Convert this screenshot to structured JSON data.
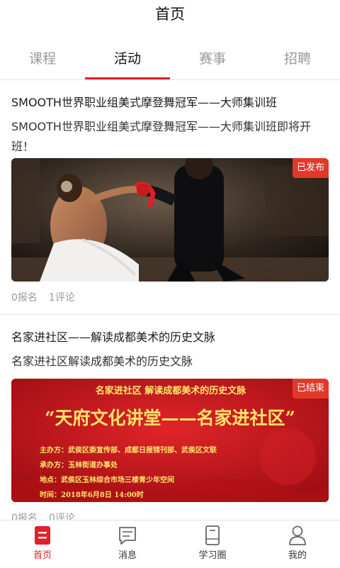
{
  "header": {
    "title": "首页"
  },
  "tabs": [
    {
      "label": "课程",
      "active": false
    },
    {
      "label": "活动",
      "active": true
    },
    {
      "label": "赛事",
      "active": false
    },
    {
      "label": "招聘",
      "active": false
    }
  ],
  "feed": [
    {
      "title": "SMOOTH世界职业组美式摩登舞冠军——大师集训班",
      "description": "SMOOTH世界职业组美式摩登舞冠军——大师集训班即将开班！",
      "status": "已发布",
      "signups": "0报名",
      "comments": "1评论"
    },
    {
      "title": "名家进社区——解读成都美术的历史文脉",
      "description": "名家进社区解读成都美术的历史文脉",
      "status": "已结束",
      "signups": "0报名",
      "comments": "0评论",
      "poster": {
        "headline": "名家进社区  解读成都美术的历史文脉",
        "main": "“天府文化讲堂——名家进社区”",
        "organizer": "主办方：武侯区委宣传部、成都日报锦刊部、武侯区文联",
        "co_organizer": "承办方：玉林街道办事处",
        "venue": "地点：武侯区玉林综合市场三楼青少年空间",
        "time": "时间：2018年6月8日 14:00时"
      }
    }
  ],
  "tabbar": [
    {
      "label": "首页",
      "icon": "home-icon",
      "active": true
    },
    {
      "label": "消息",
      "icon": "message-icon",
      "active": false
    },
    {
      "label": "学习圈",
      "icon": "book-icon",
      "active": false
    },
    {
      "label": "我的",
      "icon": "user-icon",
      "active": false
    }
  ],
  "colors": {
    "accent": "#e0202c",
    "badge": "#e0392c",
    "poster_bg": "#c8141a",
    "poster_text": "#ffe36a"
  }
}
